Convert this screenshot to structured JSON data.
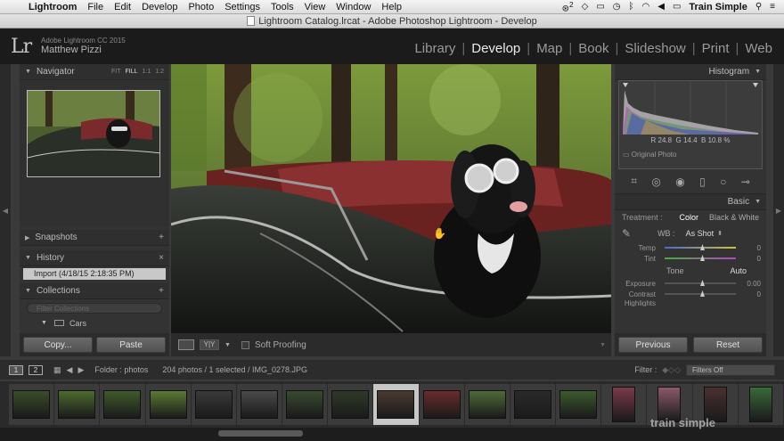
{
  "menubar": {
    "items": [
      "Lightroom",
      "File",
      "Edit",
      "Develop",
      "Photo",
      "Settings",
      "Tools",
      "View",
      "Window",
      "Help"
    ],
    "badge": "2",
    "user": "Train Simple"
  },
  "window": {
    "title": "Lightroom Catalog.lrcat - Adobe Photoshop Lightroom - Develop"
  },
  "identity": {
    "version": "Adobe Lightroom CC 2015",
    "user": "Matthew Pizzi"
  },
  "modules": [
    "Library",
    "Develop",
    "Map",
    "Book",
    "Slideshow",
    "Print",
    "Web"
  ],
  "active_module": "Develop",
  "left": {
    "navigator": {
      "title": "Navigator",
      "zoom_options": [
        "FIT",
        "FILL",
        "1:1",
        "1:2"
      ],
      "active_zoom": "FILL"
    },
    "snapshots": {
      "title": "Snapshots"
    },
    "history": {
      "title": "History",
      "item": "Import (4/18/15 2:18:35 PM)"
    },
    "collections": {
      "title": "Collections",
      "search_placeholder": "Filter Collections",
      "items": [
        "Cars"
      ]
    },
    "buttons": {
      "copy": "Copy...",
      "paste": "Paste"
    }
  },
  "toolbar": {
    "soft_proofing": "Soft Proofing"
  },
  "right": {
    "histogram": {
      "title": "Histogram",
      "r": "24.8",
      "g": "14.4",
      "b": "10.8",
      "pct": "%",
      "original_photo": "Original Photo"
    },
    "basic": {
      "title": "Basic",
      "treatment_label": "Treatment :",
      "treatment_color": "Color",
      "treatment_bw": "Black & White",
      "wb_label": "WB :",
      "wb_value": "As Shot",
      "temp": {
        "label": "Temp",
        "value": "0"
      },
      "tint": {
        "label": "Tint",
        "value": "0"
      },
      "tone_label": "Tone",
      "auto": "Auto",
      "exposure": {
        "label": "Exposure",
        "value": "0.00"
      },
      "contrast": {
        "label": "Contrast",
        "value": "0"
      },
      "highlights": {
        "label": "Highlights"
      }
    },
    "buttons": {
      "previous": "Previous",
      "reset": "Reset"
    }
  },
  "filmstrip_bar": {
    "screen1": "1",
    "screen2": "2",
    "folder": "Folder : photos",
    "count": "204 photos / 1 selected / IMG_0278.JPG",
    "filter_label": "Filter :",
    "filter_value": "Filters Off"
  },
  "filmstrip": {
    "selected_index": 8,
    "count": 17
  },
  "watermark": "train simple",
  "colors": {
    "accent": "#e6e6e6",
    "panel": "#333333",
    "background": "#3a3a3a"
  }
}
